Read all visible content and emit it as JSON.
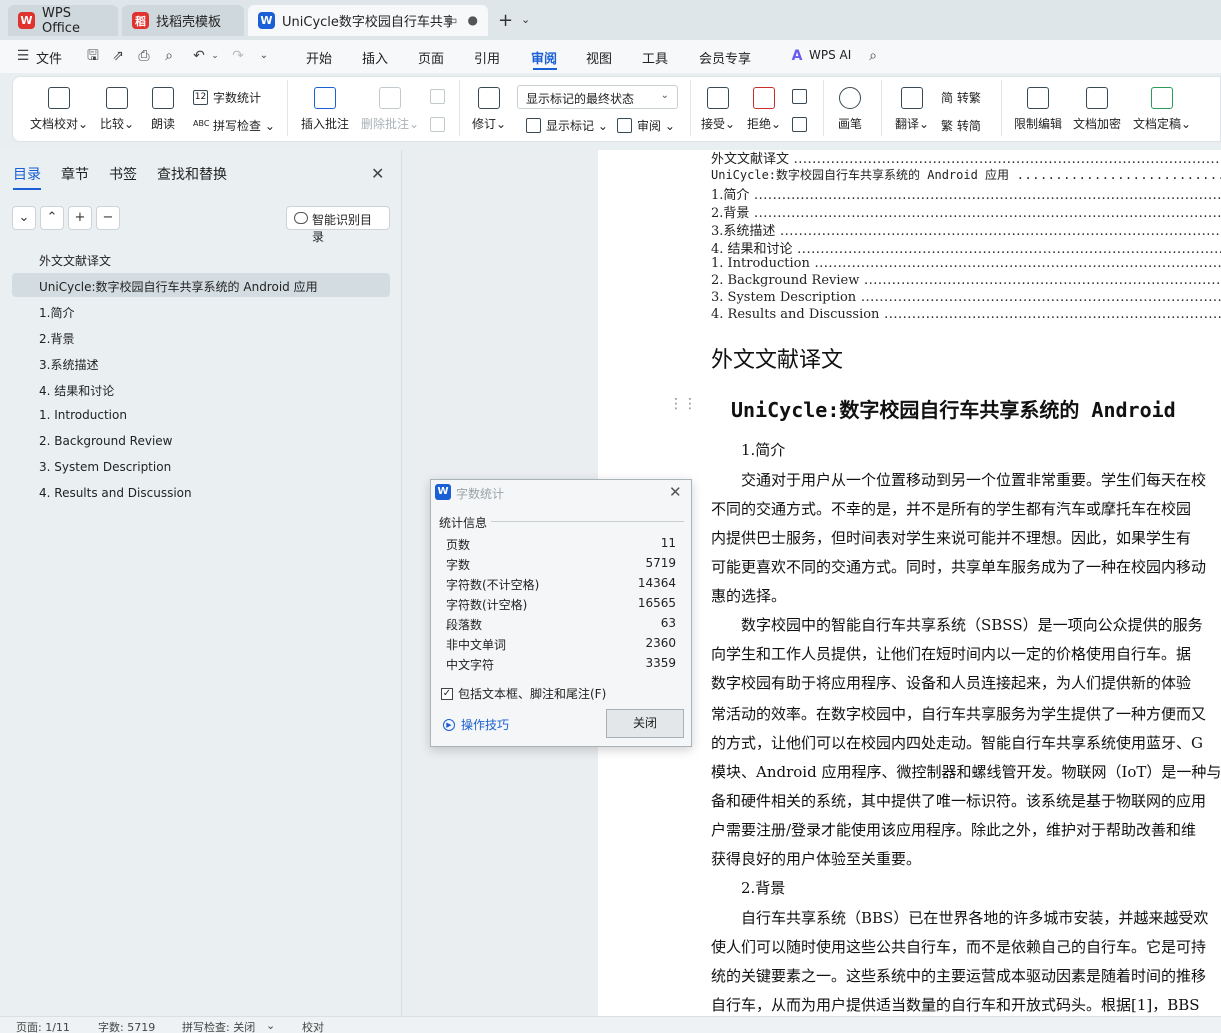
{
  "tabs": [
    {
      "label": "WPS Office",
      "icon": "wps-logo-icon",
      "color": "#e0322e"
    },
    {
      "label": "找稻壳模板",
      "icon": "docer-icon",
      "color": "#e0322e"
    },
    {
      "label": "UniCycle数字校园自行车共享系",
      "icon": "writer-icon",
      "color": "#1a5fd6"
    }
  ],
  "menubar": {
    "file": "文件",
    "items": [
      "开始",
      "插入",
      "页面",
      "引用",
      "审阅",
      "视图",
      "工具",
      "会员专享"
    ],
    "active": "审阅",
    "wps_ai": "WPS AI"
  },
  "ribbon": {
    "doc_proofread": "文档校对",
    "compare": "比较",
    "read_aloud": "朗读",
    "word_count": "字数统计",
    "spell_check": "拼写检查",
    "insert_comment": "插入批注",
    "delete_comment": "删除批注",
    "revise": "修订",
    "markup_state": "显示标记的最终状态",
    "show_markup": "显示标记",
    "review_pane": "审阅",
    "accept": "接受",
    "reject": "拒绝",
    "pen": "画笔",
    "translate": "翻译",
    "to_traditional": "简 转繁",
    "to_simplified": "繁 转简",
    "restrict_edit": "限制编辑",
    "encrypt": "文档加密",
    "finalize": "文档定稿"
  },
  "nav": {
    "tabs": [
      "目录",
      "章节",
      "书签",
      "查找和替换"
    ],
    "smart_toc": "智能识别目录",
    "toc": [
      "外文文献译文",
      "UniCycle:数字校园自行车共享系统的 Android 应用",
      "1.简介",
      "2.背景",
      "3.系统描述",
      "4. 结果和讨论",
      "1. Introduction",
      "2. Background Review",
      "3. System Description",
      "4. Results and Discussion"
    ]
  },
  "doc": {
    "toc_lines": [
      "外文文献译文",
      "UniCycle:数字校园自行车共享系统的 Android 应用",
      "1.简介",
      "2.背景",
      "3.系统描述",
      "4. 结果和讨论",
      "1. Introduction",
      "2. Background Review",
      "3. System Description",
      "4. Results and Discussion"
    ],
    "heading1": "外文文献译文",
    "main_title": "UniCycle:数字校园自行车共享系统的 Android",
    "lines": [
      "1.简介",
      "交通对于用户从一个位置移动到另一个位置非常重要。学生们每天在校",
      "不同的交通方式。不幸的是，并不是所有的学生都有汽车或摩托车在校园",
      "内提供巴士服务，但时间表对学生来说可能并不理想。因此，如果学生有",
      "可能更喜欢不同的交通方式。同时，共享单车服务成为了一种在校园内移动",
      "惠的选择。",
      "数字校园中的智能自行车共享系统（SBSS）是一项向公众提供的服务",
      "向学生和工作人员提供，让他们在短时间内以一定的价格使用自行车。据",
      "数字校园有助于将应用程序、设备和人员连接起来，为人们提供新的体验",
      "常活动的效率。在数字校园中，自行车共享服务为学生提供了一种方便而又",
      "的方式，让他们可以在校园内四处走动。智能自行车共享系统使用蓝牙、G",
      "模块、Android 应用程序、微控制器和螺线管开发。物联网（IoT）是一种与",
      "备和硬件相关的系统，其中提供了唯一标识符。该系统是基于物联网的应用",
      "户需要注册/登录才能使用该应用程序。除此之外，维护对于帮助改善和维",
      "获得良好的用户体验至关重要。",
      "2.背景",
      "自行车共享系统（BBS）已在世界各地的许多城市安装，并越来越受欢",
      "使人们可以随时使用这些公共自行车，而不是依赖自己的自行车。它是可持",
      "统的关键要素之一。这些系统中的主要运营成本驱动因素是随着时间的推移",
      "自行车，从而为用户提供适当数量的自行车和开放式码头。根据[1]，BBS"
    ]
  },
  "dialog": {
    "title": "字数统计",
    "group": "统计信息",
    "stats": [
      {
        "label": "页数",
        "value": "11"
      },
      {
        "label": "字数",
        "value": "5719"
      },
      {
        "label": "字符数(不计空格)",
        "value": "14364"
      },
      {
        "label": "字符数(计空格)",
        "value": "16565"
      },
      {
        "label": "段落数",
        "value": "63"
      },
      {
        "label": "非中文单词",
        "value": "2360"
      },
      {
        "label": "中文字符",
        "value": "3359"
      }
    ],
    "include_label": "包括文本框、脚注和尾注(F)",
    "include_checked": true,
    "tips": "操作技巧",
    "close": "关闭"
  },
  "status": {
    "page": "页面: 1/11",
    "words": "字数: 5719",
    "spell": "拼写检查: 关闭",
    "proof": "校对"
  }
}
